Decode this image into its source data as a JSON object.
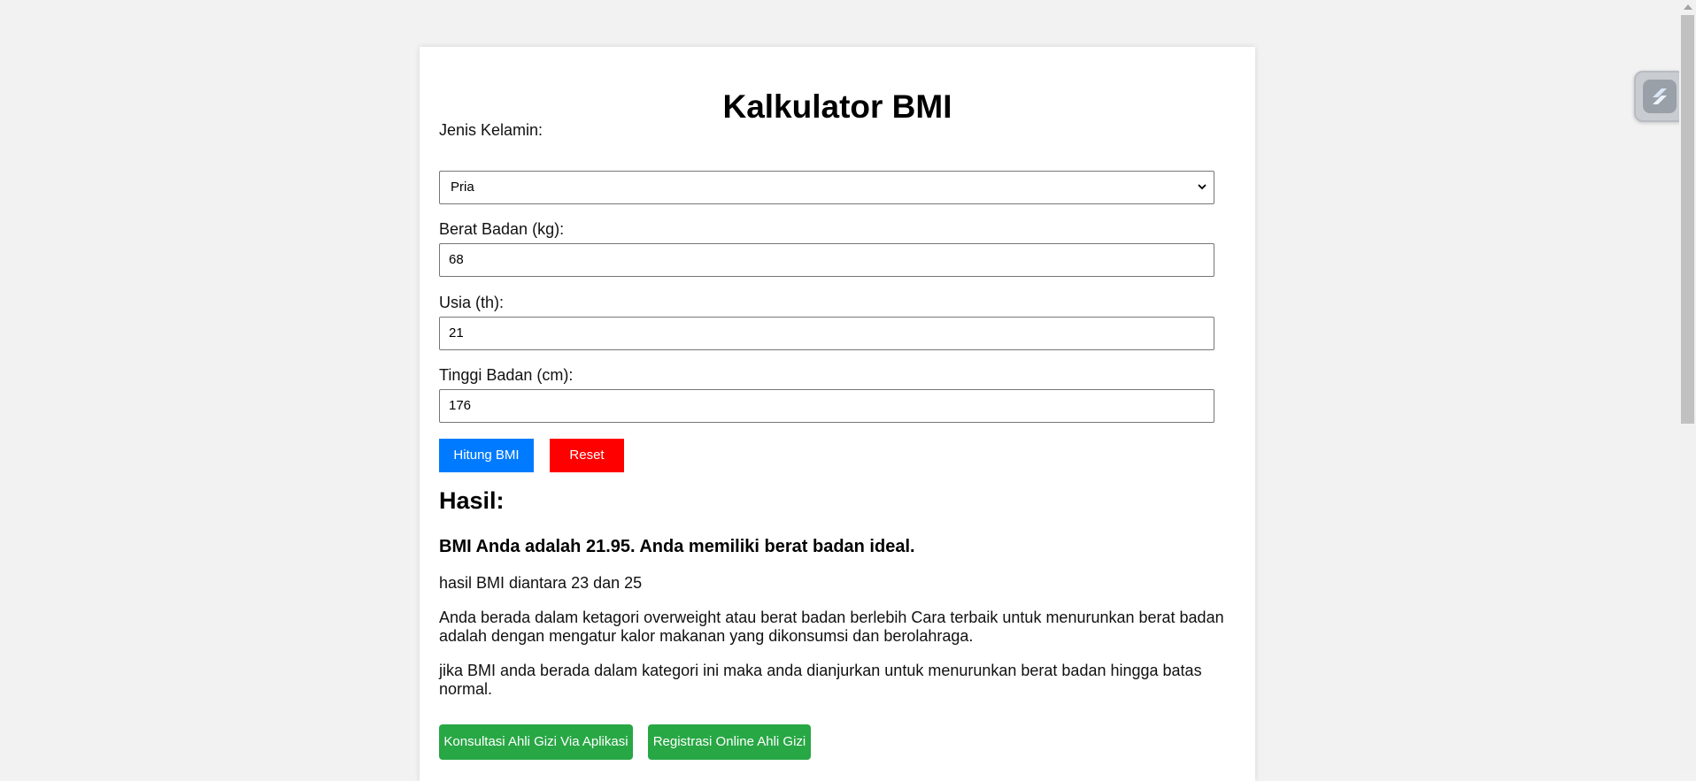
{
  "page": {
    "title": "Kalkulator BMI"
  },
  "form": {
    "gender_label": "Jenis Kelamin:",
    "gender_value": "Pria",
    "weight_label": "Berat Badan (kg):",
    "weight_value": "68",
    "age_label": "Usia (th):",
    "age_value": "21",
    "height_label": "Tinggi Badan (cm):",
    "height_value": "176"
  },
  "actions": {
    "calculate_label": "Hitung BMI",
    "reset_label": "Reset"
  },
  "result": {
    "heading": "Hasil:",
    "bmi_text": "BMI Anda adalah 21.95. Anda memiliki berat badan ideal.",
    "range_text": "hasil BMI diantara 23 dan 25",
    "category_text": "Anda berada dalam ketagori overweight atau berat badan berlebih Cara terbaik untuk menurunkan berat badan adalah dengan mengatur kalor makanan yang dikonsumsi dan berolahraga.",
    "advice_text": "jika BMI anda berada dalam kategori ini maka anda dianjurkan untuk menurunkan berat badan hingga batas normal."
  },
  "links": {
    "consult_label": "Konsultasi Ahli Gizi Via Aplikasi",
    "register_label": "Registrasi Online Ahli Gizi"
  },
  "colors": {
    "page_bg": "#f2f2f2",
    "primary_button": "#007bff",
    "reset_button": "#ff0000",
    "link_button": "#28a745"
  },
  "icons": {
    "select_arrow": "chevron-down-icon",
    "floating_widget": "extension-icon"
  }
}
